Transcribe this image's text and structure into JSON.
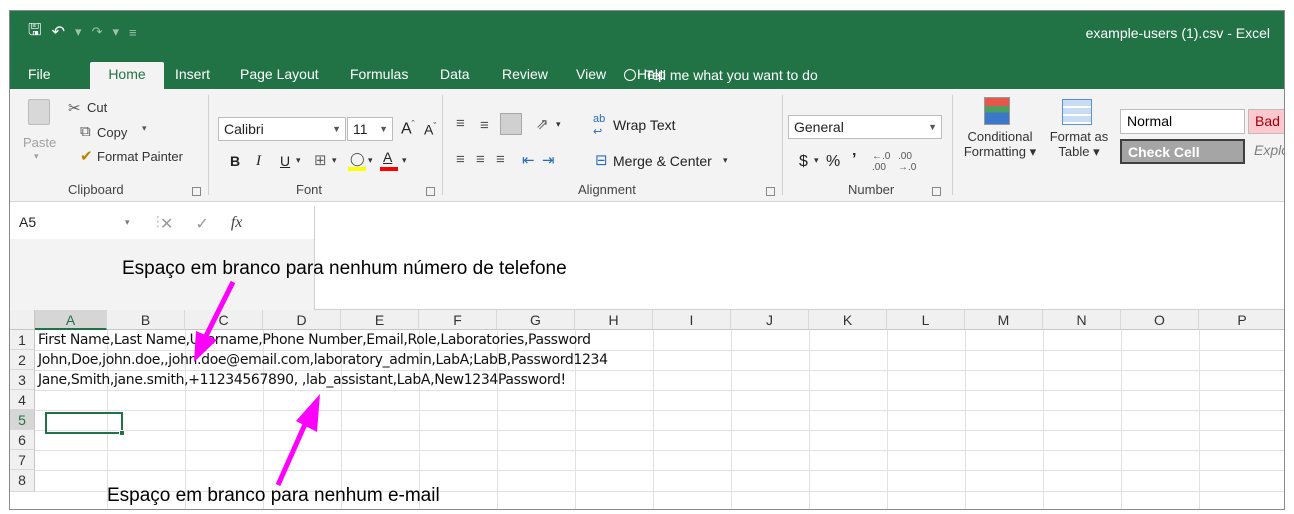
{
  "window": {
    "title": "example-users (1).csv  -  Excel"
  },
  "ribbon_tabs": [
    "File",
    "Home",
    "Insert",
    "Page Layout",
    "Formulas",
    "Data",
    "Review",
    "View",
    "Help"
  ],
  "tell_me": "Tell me what you want to do",
  "clipboard": {
    "paste": "Paste",
    "cut": "Cut",
    "copy": "Copy",
    "format_painter": "Format Painter",
    "label": "Clipboard"
  },
  "font": {
    "name": "Calibri",
    "size": "11",
    "bold": "B",
    "italic": "I",
    "underline": "U",
    "label": "Font"
  },
  "alignment": {
    "wrap_text": "Wrap Text",
    "merge_center": "Merge & Center",
    "label": "Alignment"
  },
  "number": {
    "format": "General",
    "currency": "$",
    "percent": "%",
    "comma": "͙",
    "label": "Number"
  },
  "styles": {
    "conditional_1": "Conditional",
    "conditional_2": "Formatting",
    "format_as_1": "Format as",
    "format_as_2": "Table",
    "normal": "Normal",
    "bad": "Bad",
    "check_cell": "Check Cell",
    "explanatory": "Explo"
  },
  "formula_bar": {
    "name_box": "A5",
    "fx": "fx",
    "value": ""
  },
  "columns": [
    "A",
    "B",
    "C",
    "D",
    "E",
    "F",
    "G",
    "H",
    "I",
    "J",
    "K",
    "L",
    "M",
    "N",
    "O",
    "P"
  ],
  "rows": [
    "1",
    "2",
    "3",
    "4",
    "5",
    "6",
    "7",
    "8"
  ],
  "cells": {
    "A1": "First Name,Last Name,Username,Phone Number,Email,Role,Laboratories,Password",
    "A2": "John,Doe,john.doe,,john.doe@email.com,laboratory_admin,LabA;LabB,Password1234",
    "A3": "Jane,Smith,jane.smith,+11234567890, ,lab_assistant,LabA,New1234Password!"
  },
  "annotations": {
    "phone": "Espaço em branco para nenhum número de telefone",
    "email": "Espaço em branco para nenhum e-mail",
    "color": "#ff00ff"
  }
}
